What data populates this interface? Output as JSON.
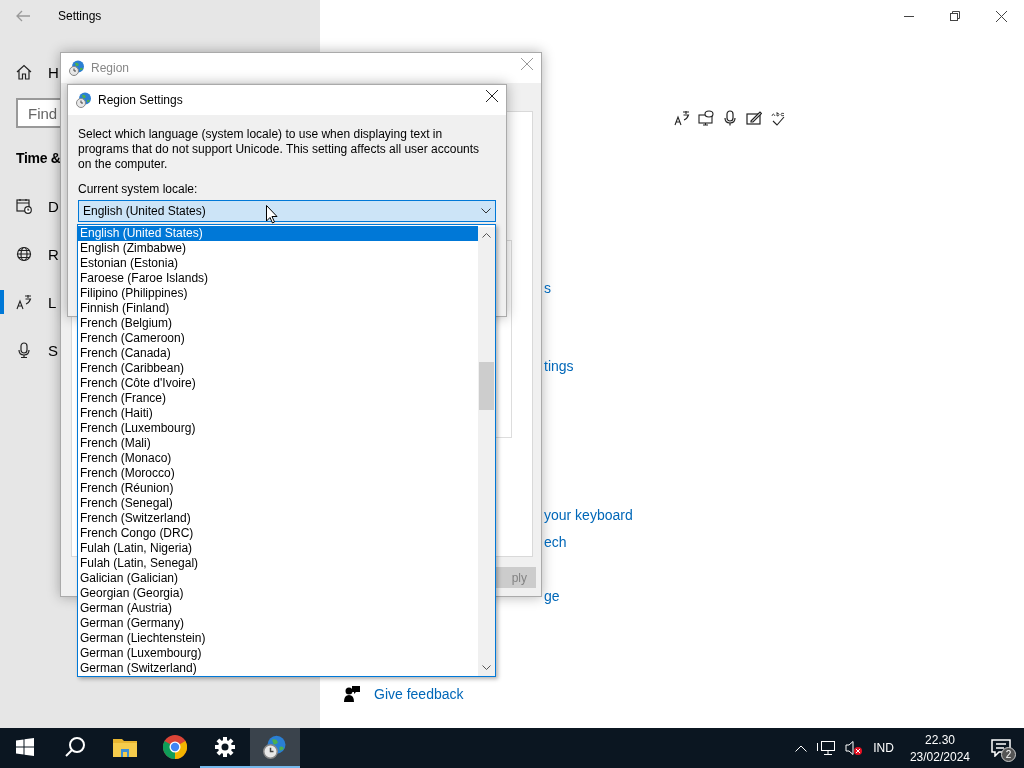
{
  "settings": {
    "title": "Settings",
    "home": "H",
    "search": {
      "placeholder": "Find"
    },
    "section": "Time &",
    "nav": [
      {
        "label": "D",
        "selected": false
      },
      {
        "label": "R",
        "selected": false
      },
      {
        "label": "L",
        "selected": true
      },
      {
        "label": "S",
        "selected": false
      }
    ],
    "links": [
      "s",
      "tings",
      "your keyboard",
      "ech",
      "ge"
    ],
    "feedback": "Give feedback"
  },
  "region_window": {
    "title": "Region",
    "apply_button": {
      "label": "ply",
      "disabled": true
    }
  },
  "region_settings": {
    "title": "Region Settings",
    "description": "Select which language (system locale) to use when displaying text in programs that do not support Unicode. This setting affects all user accounts on the computer.",
    "locale_label": "Current system locale:",
    "locale_value": "English (United States)",
    "options": [
      {
        "label": "English (United States)",
        "selected": true
      },
      {
        "label": "English (Zimbabwe)",
        "selected": false
      },
      {
        "label": "Estonian (Estonia)",
        "selected": false
      },
      {
        "label": "Faroese (Faroe Islands)",
        "selected": false
      },
      {
        "label": "Filipino (Philippines)",
        "selected": false
      },
      {
        "label": "Finnish (Finland)",
        "selected": false
      },
      {
        "label": "French (Belgium)",
        "selected": false
      },
      {
        "label": "French (Cameroon)",
        "selected": false
      },
      {
        "label": "French (Canada)",
        "selected": false
      },
      {
        "label": "French (Caribbean)",
        "selected": false
      },
      {
        "label": "French (Côte d'Ivoire)",
        "selected": false
      },
      {
        "label": "French (France)",
        "selected": false
      },
      {
        "label": "French (Haiti)",
        "selected": false
      },
      {
        "label": "French (Luxembourg)",
        "selected": false
      },
      {
        "label": "French (Mali)",
        "selected": false
      },
      {
        "label": "French (Monaco)",
        "selected": false
      },
      {
        "label": "French (Morocco)",
        "selected": false
      },
      {
        "label": "French (Réunion)",
        "selected": false
      },
      {
        "label": "French (Senegal)",
        "selected": false
      },
      {
        "label": "French (Switzerland)",
        "selected": false
      },
      {
        "label": "French Congo (DRC)",
        "selected": false
      },
      {
        "label": "Fulah (Latin, Nigeria)",
        "selected": false
      },
      {
        "label": "Fulah (Latin, Senegal)",
        "selected": false
      },
      {
        "label": "Galician (Galician)",
        "selected": false
      },
      {
        "label": "Georgian (Georgia)",
        "selected": false
      },
      {
        "label": "German (Austria)",
        "selected": false
      },
      {
        "label": "German (Germany)",
        "selected": false
      },
      {
        "label": "German (Liechtenstein)",
        "selected": false
      },
      {
        "label": "German (Luxembourg)",
        "selected": false
      },
      {
        "label": "German (Switzerland)",
        "selected": false
      }
    ]
  },
  "taskbar": {
    "apps": [
      {
        "kind": "start",
        "running": false,
        "selected": false
      },
      {
        "kind": "search",
        "running": false,
        "selected": false
      },
      {
        "kind": "explorer",
        "running": false,
        "selected": false
      },
      {
        "kind": "chrome",
        "running": false,
        "selected": false
      },
      {
        "kind": "settings",
        "running": true,
        "selected": false
      },
      {
        "kind": "region",
        "running": true,
        "selected": true
      }
    ],
    "language": "IND",
    "time": "22.30",
    "date": "23/02/2024",
    "notifications": "2"
  }
}
